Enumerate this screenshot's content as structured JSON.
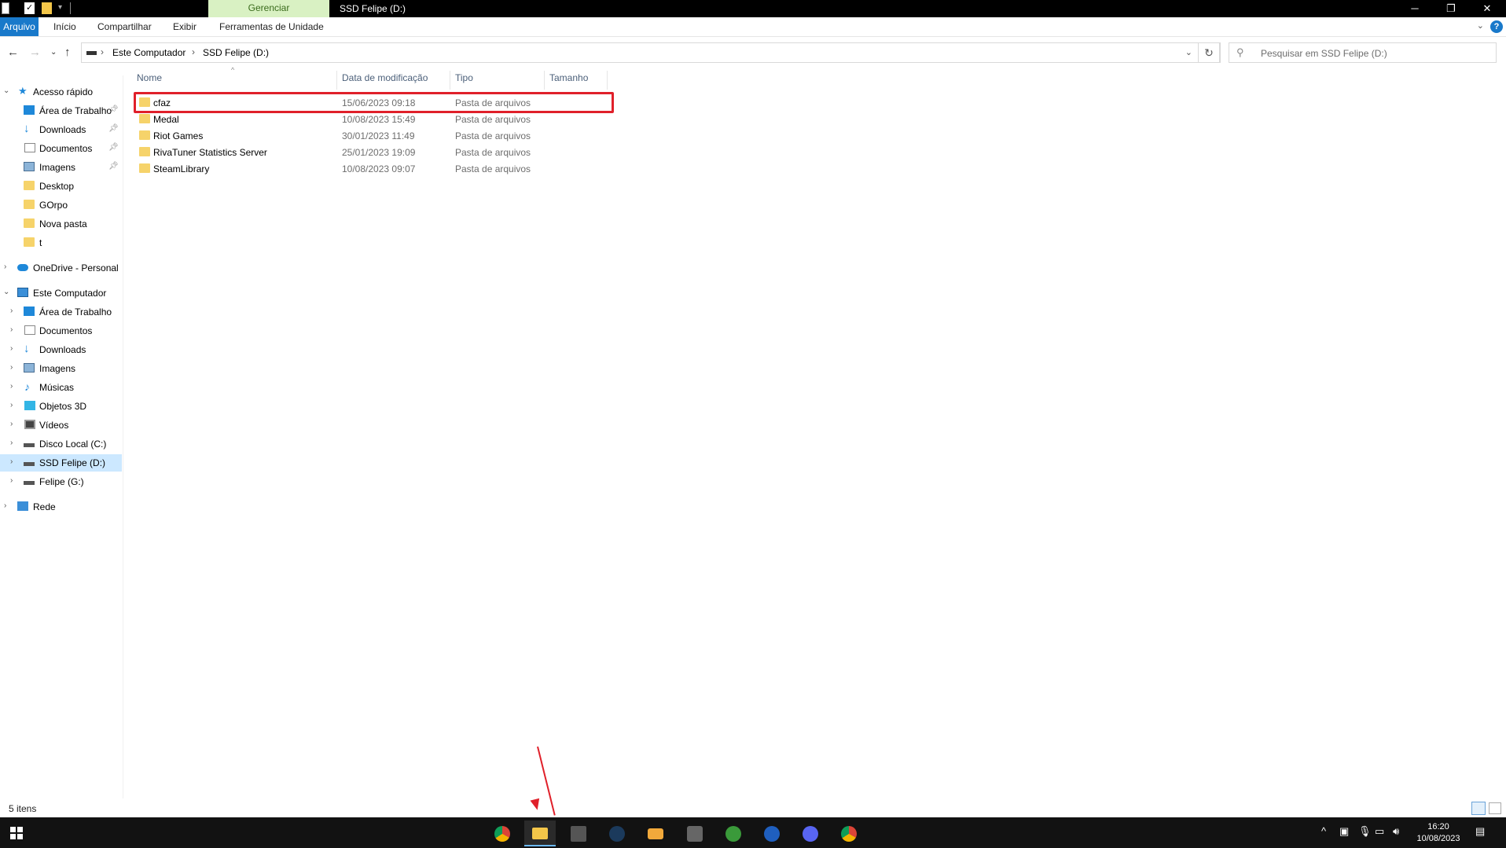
{
  "window": {
    "context_tab": "Gerenciar",
    "title": "SSD Felipe (D:)",
    "minimize": "─",
    "restore": "❐",
    "close": "✕"
  },
  "ribbon": {
    "tabs": [
      "Arquivo",
      "Início",
      "Compartilhar",
      "Exibir",
      "Ferramentas de Unidade"
    ],
    "help": "?"
  },
  "address": {
    "crumbs": [
      "Este Computador",
      "SSD Felipe (D:)"
    ],
    "search_placeholder": "Pesquisar em SSD Felipe (D:)"
  },
  "nav": {
    "quick_access": "Acesso rápido",
    "quick_items": [
      "Área de Trabalho",
      "Downloads",
      "Documentos",
      "Imagens",
      "Desktop",
      "GOrpo",
      "Nova pasta",
      "t"
    ],
    "onedrive": "OneDrive - Personal",
    "this_pc": "Este Computador",
    "pc_items": [
      "Área de Trabalho",
      "Documentos",
      "Downloads",
      "Imagens",
      "Músicas",
      "Objetos 3D",
      "Vídeos",
      "Disco Local (C:)",
      "SSD Felipe (D:)",
      "Felipe (G:)"
    ],
    "network": "Rede"
  },
  "columns": {
    "name": "Nome",
    "date": "Data de modificação",
    "type": "Tipo",
    "size": "Tamanho"
  },
  "files": [
    {
      "name": "cfaz",
      "date": "15/06/2023 09:18",
      "type": "Pasta de arquivos"
    },
    {
      "name": "Medal",
      "date": "10/08/2023 15:49",
      "type": "Pasta de arquivos"
    },
    {
      "name": "Riot Games",
      "date": "30/01/2023 11:49",
      "type": "Pasta de arquivos"
    },
    {
      "name": "RivaTuner Statistics Server",
      "date": "25/01/2023 19:09",
      "type": "Pasta de arquivos"
    },
    {
      "name": "SteamLibrary",
      "date": "10/08/2023 09:07",
      "type": "Pasta de arquivos"
    }
  ],
  "status": {
    "count": "5 itens"
  },
  "taskbar": {
    "apps": [
      "chrome-icon",
      "file-explorer-icon",
      "cpu-z-icon",
      "steam-icon",
      "medal-icon",
      "unity-icon",
      "xbox-icon",
      "teamviewer-icon",
      "discord-icon",
      "chrome-profile-icon"
    ],
    "time": "16:20",
    "date": "10/08/2023"
  },
  "colors": {
    "accent": "#1979ca",
    "highlight": "#e0202a",
    "context_tab": "#d9f1c3",
    "folder": "#f6d36a"
  }
}
